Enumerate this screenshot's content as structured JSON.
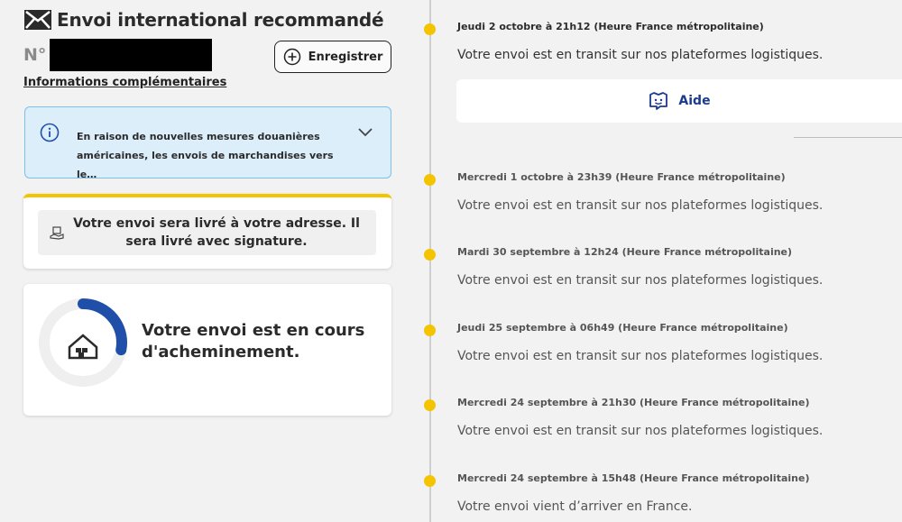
{
  "header": {
    "title": "Envoi international recommandé",
    "number_label": "N°",
    "save_label": "Enregistrer",
    "info_link": "Informations complémentaires"
  },
  "notice": {
    "text": "En raison de nouvelles mesures douanières américaines, les envois de marchandises vers le…"
  },
  "delivery": {
    "text": "Votre envoi sera livré à votre adresse. Il sera livré avec signature."
  },
  "status": {
    "text": "Votre envoi est en cours d'acheminement.",
    "progress": 0.28,
    "progress_color": "#1f4fa8"
  },
  "help": {
    "label": "Aide"
  },
  "colors": {
    "accent_yellow": "#f5c400",
    "brand_blue": "#1a3a8c",
    "notice_bg": "#dbeefa"
  },
  "timeline": [
    {
      "date": "Jeudi 2 octobre à 21h12 (Heure France métropolitaine)",
      "message": "Votre envoi est en transit sur nos plateformes logistiques."
    },
    {
      "date": "Mercredi 1 octobre à 23h39 (Heure France métropolitaine)",
      "message": "Votre envoi est en transit sur nos plateformes logistiques."
    },
    {
      "date": "Mardi 30 septembre à 12h24 (Heure France métropolitaine)",
      "message": "Votre envoi est en transit sur nos plateformes logistiques."
    },
    {
      "date": "Jeudi 25 septembre à 06h49 (Heure France métropolitaine)",
      "message": "Votre envoi est en transit sur nos plateformes logistiques."
    },
    {
      "date": "Mercredi 24 septembre à 21h30 (Heure France métropolitaine)",
      "message": "Votre envoi est en transit sur nos plateformes logistiques."
    },
    {
      "date": "Mercredi 24 septembre à 15h48 (Heure France métropolitaine)",
      "message": "Votre envoi vient d’arriver en France."
    }
  ]
}
